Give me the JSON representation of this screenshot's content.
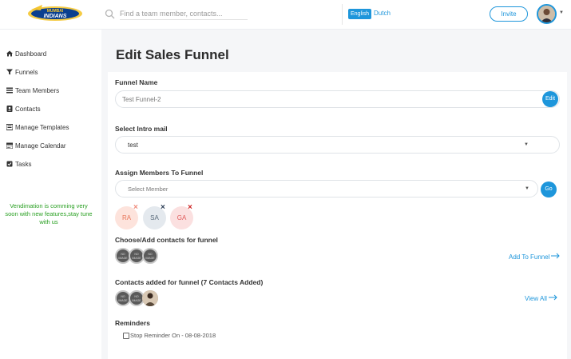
{
  "header": {
    "logo_text": "MUMBAI INDIANS",
    "search_placeholder": "Find a team member, contacts...",
    "lang_english": "English",
    "lang_dutch": "Dutch",
    "invite_label": "Invite"
  },
  "sidebar": {
    "items": [
      {
        "label": "Dashboard",
        "icon": "home-icon"
      },
      {
        "label": "Funnels",
        "icon": "filter-icon"
      },
      {
        "label": "Team Members",
        "icon": "list-icon"
      },
      {
        "label": "Contacts",
        "icon": "address-book-icon"
      },
      {
        "label": "Manage Templates",
        "icon": "template-icon"
      },
      {
        "label": "Manage Calendar",
        "icon": "calendar-icon"
      },
      {
        "label": "Tasks",
        "icon": "tasks-icon"
      }
    ],
    "promo": "Vendimation is comming very soon with new features,stay tune with us"
  },
  "main": {
    "title": "Edit Sales Funnel",
    "funnel_name_label": "Funnel Name",
    "funnel_name_value": "Test Funnel-2",
    "edit_label": "Edit",
    "intro_mail_label": "Select Intro mail",
    "intro_mail_value": "test",
    "assign_label": "Assign Members To Funnel",
    "member_placeholder": "Select Member",
    "go_label": "Go",
    "members": [
      {
        "initials": "RA",
        "bg": "#fde3dc",
        "color": "#e8765a",
        "x_color": "#f08a7a"
      },
      {
        "initials": "SA",
        "bg": "#e4e9ee",
        "color": "#5a6b7b",
        "x_color": "#2b3d55"
      },
      {
        "initials": "GA",
        "bg": "#fbe0e0",
        "color": "#e05a5a",
        "x_color": "#cc1f1f"
      }
    ],
    "choose_contacts_label": "Choose/Add contacts for funnel",
    "add_to_funnel_label": "Add To Funnel",
    "contacts_added_label": "Contacts added for funnel (7 Contacts Added)",
    "view_all_label": "View All",
    "contact_placeholder_text": "NO IMAGE",
    "reminders_label": "Reminders",
    "reminder_text": "Stop Reminder On - 08-08-2018"
  },
  "colors": {
    "accent": "#1e96db",
    "promo": "#2aa023"
  }
}
